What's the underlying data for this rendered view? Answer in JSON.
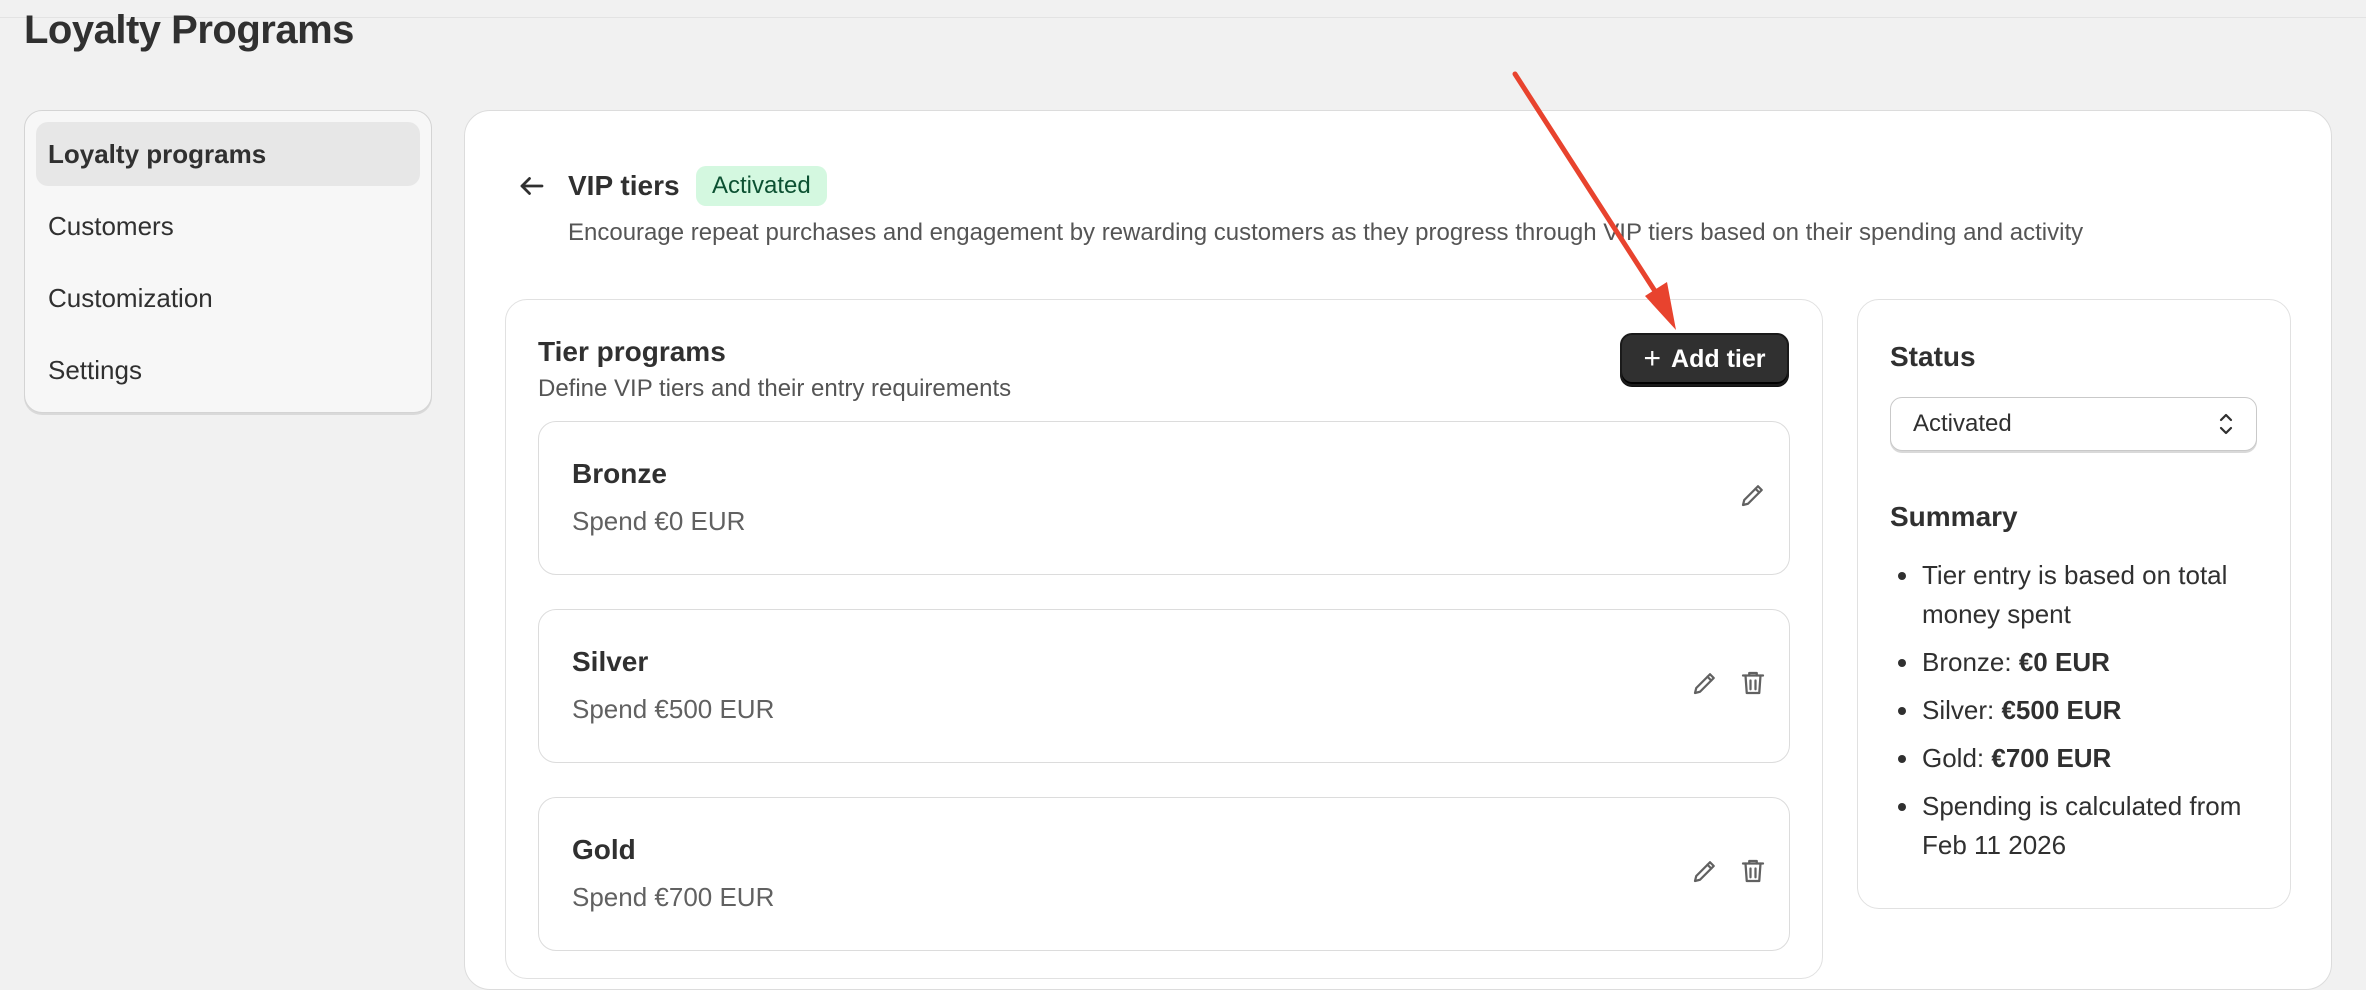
{
  "page": {
    "title": "Loyalty Programs"
  },
  "sidebar": {
    "items": [
      {
        "label": "Loyalty programs",
        "active": true
      },
      {
        "label": "Customers",
        "active": false
      },
      {
        "label": "Customization",
        "active": false
      },
      {
        "label": "Settings",
        "active": false
      }
    ]
  },
  "header": {
    "back_icon": "arrow-left-icon",
    "title": "VIP tiers",
    "status_badge": "Activated",
    "description": "Encourage repeat purchases and engagement by rewarding customers as they progress through VIP tiers based on their spending and activity"
  },
  "tiers_card": {
    "title": "Tier programs",
    "subtitle": "Define VIP tiers and their entry requirements",
    "add_button_label": "Add tier",
    "add_button_icon": "plus-icon",
    "tiers": [
      {
        "name": "Bronze",
        "requirement": "Spend €0 EUR",
        "editable": true,
        "deletable": false
      },
      {
        "name": "Silver",
        "requirement": "Spend €500 EUR",
        "editable": true,
        "deletable": true
      },
      {
        "name": "Gold",
        "requirement": "Spend €700 EUR",
        "editable": true,
        "deletable": true
      }
    ]
  },
  "status_card": {
    "status_label": "Status",
    "status_value": "Activated",
    "summary_label": "Summary",
    "summary": [
      {
        "text": "Tier entry is based on total money spent"
      },
      {
        "prefix": "Bronze: ",
        "value": "€0 EUR"
      },
      {
        "prefix": "Silver: ",
        "value": "€500 EUR"
      },
      {
        "prefix": "Gold: ",
        "value": "€700 EUR"
      },
      {
        "text": "Spending is calculated from Feb 11 2026"
      }
    ]
  },
  "colors": {
    "primary_button": "#303030",
    "badge_bg": "#d4f8e0",
    "badge_text": "#0c5132",
    "annotation_arrow": "#e8432e"
  }
}
